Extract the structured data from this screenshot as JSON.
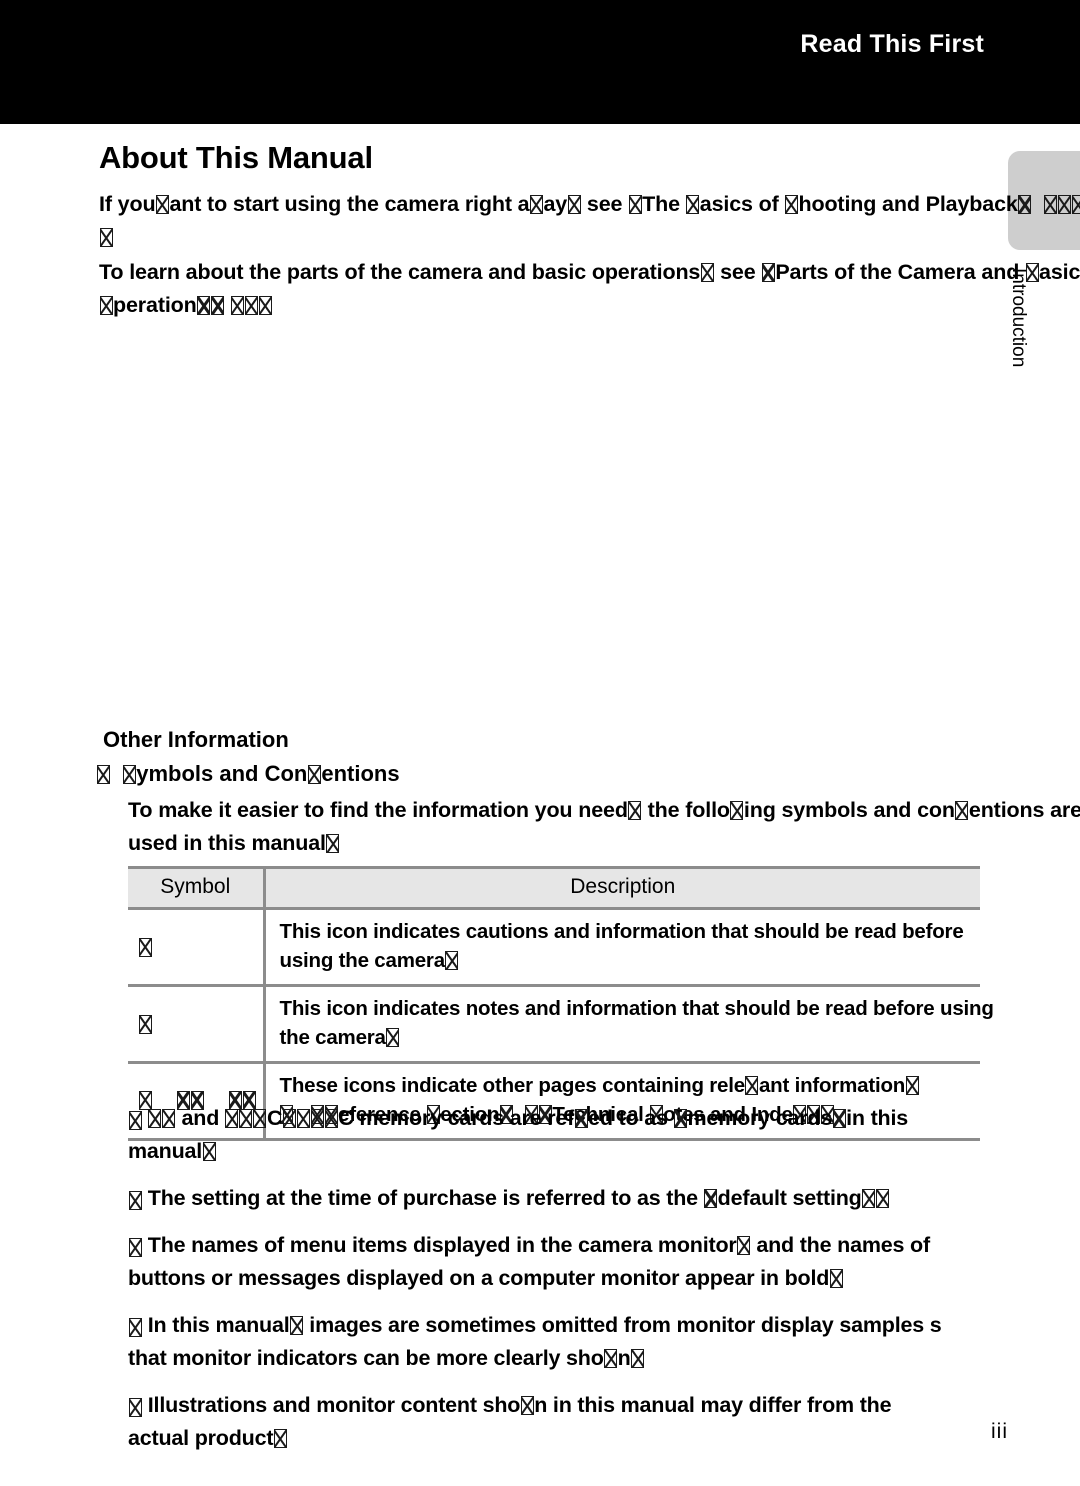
{
  "header": {
    "title": "Read This First",
    "band_color": "#000000",
    "text_color": "#ffffff"
  },
  "section_tab": {
    "label": "Introduction",
    "color": "#cecece"
  },
  "page": {
    "title": "About This Manual",
    "number": "iii"
  },
  "intro": {
    "paragraph_1": "If you ⌧ant to start using the camera right a⌧ay⌧ see ⌧The ⌧asics of ⌧hooting and Playback⌧ ⌧⌧⌧⌧",
    "paragraph_1_plain": "If you want to start using the camera right away, see “The Basics of Shooting and Playback” (A10).",
    "paragraph_2": "To learn about the parts of the camera and basic operations⌧ see ⌧Parts of the Camera and ⌧asic ⌧perations⌧⌧ ⌧⌧⌧",
    "paragraph_2_plain": "To learn about the parts of the camera and basic operations, see “Parts of the Camera and Basic Operations” (A1)."
  },
  "other_information": {
    "heading": "Other Information",
    "symbols_heading": "ymbols and Con entions",
    "symbols_heading_plain": "Symbols and Conventions",
    "body_line_1": "To make it easier to find the information you need  the follo ing symbols and",
    "body_line_2": "con entions are used in this manual",
    "body_plain": "To make it easier to find the information you need, the following symbols and conventions are used in this manual."
  },
  "table": {
    "columns": [
      "Symbol",
      "Description"
    ],
    "header_bg": "#e6e6e6",
    "rule_color": "#8c8c8c",
    "rows": [
      {
        "symbols": 1,
        "symbol_widths": [
          1
        ],
        "description_line_1": "This icon indicates cautions and information that should be read before",
        "description_line_2": "using the camera",
        "description_plain": "This icon indicates cautions and information that should be read before using the camera."
      },
      {
        "symbols": 1,
        "symbol_widths": [
          1
        ],
        "description_line_1": "This icon indicates notes and information that should be read before using",
        "description_line_2": "the camera",
        "description_plain": "This icon indicates notes and information that should be read before using the camera."
      },
      {
        "symbols": 3,
        "symbol_widths": [
          1,
          2,
          2
        ],
        "description_line_1": "These icons indicate other pages containing rele ant information",
        "description_line_2": "    eference  ection    Technical  otes and Inde",
        "description_plain": "These icons indicate other pages containing relevant information; E (Reference Section), F (Technical Notes and Index)."
      }
    ]
  },
  "bullets": [
    {
      "line_1_pre": " and ",
      "line_1_mid": "C",
      "line_1_post": "C memory cards are referred to as  memory cards  in this",
      "line_2": "manual",
      "plain": "SD and SDHC/SDXC memory cards are referred to as “memory cards” in this manual."
    },
    {
      "line_1": "The setting at the time of purchase is referred to as the  default setting",
      "plain": "The setting at the time of purchase is referred to as the “default setting.”"
    },
    {
      "line_1": "The names of menu items displayed in the camera monitor  and the names of",
      "line_2": "buttons or messages displayed on a computer monitor appear in bold",
      "plain": "The names of menu items displayed in the camera monitor, and the names of buttons or messages displayed on a computer monitor appear in bold."
    },
    {
      "line_1": "In this manual  images are sometimes omitted from monitor display samples s",
      "line_2": "that monitor indicators can be more clearly sho n",
      "plain": "In this manual, images are sometimes omitted from monitor display samples so that monitor indicators can be more clearly shown."
    },
    {
      "line_1": "Illustrations and monitor content sho n in this manual may differ from the",
      "line_2": "actual product",
      "plain": "Illustrations and monitor content shown in this manual may differ from the actual product."
    }
  ]
}
